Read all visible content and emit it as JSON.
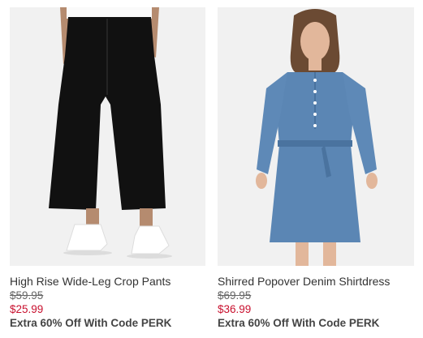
{
  "products": [
    {
      "name": "High Rise Wide-Leg Crop Pants",
      "original_price": "$59.95",
      "sale_price": "$25.99",
      "promo": "Extra 60% Off With Code PERK"
    },
    {
      "name": "Shirred Popover Denim Shirtdress",
      "original_price": "$69.95",
      "sale_price": "$36.99",
      "promo": "Extra 60% Off With Code PERK"
    }
  ],
  "colors": {
    "sale_price": "#c8102e",
    "photo_background": "#f1f1f1",
    "pants": "#111111",
    "denim": "#5b86b4"
  }
}
